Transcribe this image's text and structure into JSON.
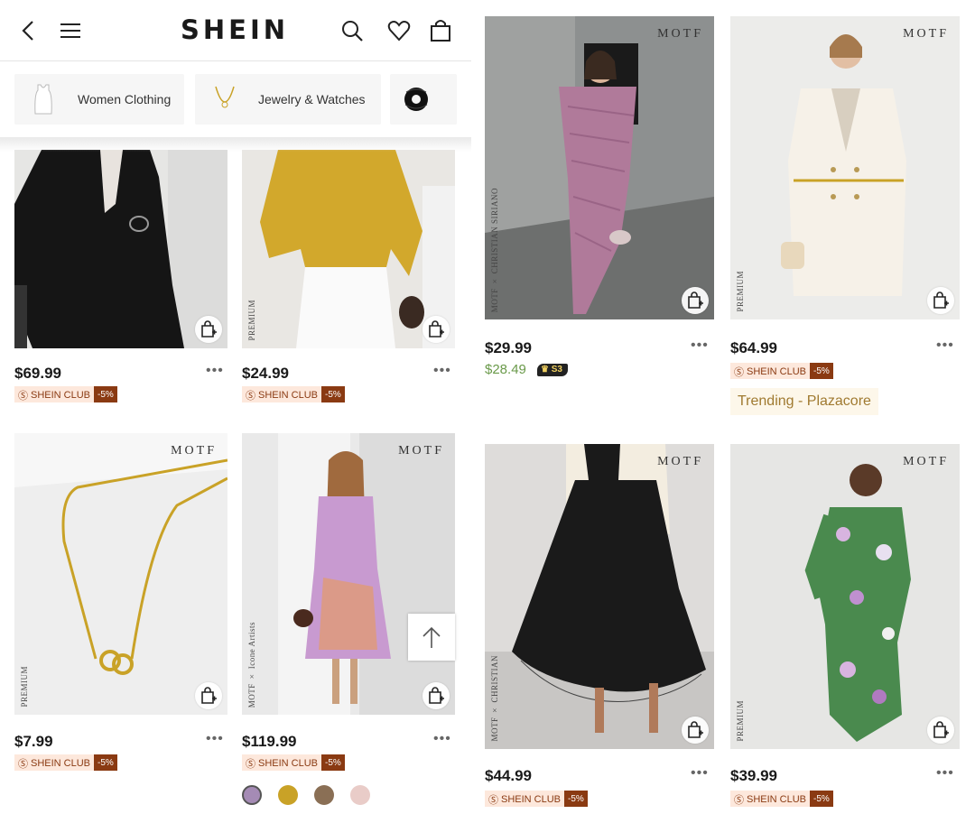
{
  "header": {
    "logo": "SHEIN",
    "icons": [
      "back-arrow-icon",
      "menu-icon",
      "search-icon",
      "heart-icon",
      "bag-icon"
    ]
  },
  "categories": [
    {
      "label": "Women Clothing",
      "icon": "tank-top-icon"
    },
    {
      "label": "Jewelry & Watches",
      "icon": "necklace-icon"
    },
    {
      "label": "",
      "icon": "scrunchie-icon"
    }
  ],
  "left_products": [
    {
      "price": "$69.99",
      "club": "SHEIN CLUB",
      "discount": "-5%",
      "image": "black blazer with belt"
    },
    {
      "price": "$24.99",
      "club": "SHEIN CLUB",
      "discount": "-5%",
      "tag": "PREMIUM",
      "image": "mustard blouse with white pants"
    },
    {
      "price": "$7.99",
      "club": "SHEIN CLUB",
      "discount": "-5%",
      "tag": "PREMIUM",
      "brand": "MOTF",
      "image": "gold layered necklace"
    },
    {
      "price": "$119.99",
      "club": "SHEIN CLUB",
      "discount": "-5%",
      "tag": "MOTF × Icone Artists",
      "brand": "MOTF",
      "image": "tie-dye twist front dress"
    }
  ],
  "right_products": [
    {
      "price": "$29.99",
      "club_price": "$28.49",
      "badge": "S3",
      "brand": "MOTF",
      "tag": "MOTF × CHRISTIAN SIRIANO",
      "image": "mauve off-shoulder ruched dress"
    },
    {
      "price": "$64.99",
      "club": "SHEIN CLUB",
      "discount": "-5%",
      "brand": "MOTF",
      "tag": "PREMIUM",
      "trending": "Trending - Plazacore",
      "image": "cream tweed blazer dress"
    },
    {
      "price": "$44.99",
      "club": "SHEIN CLUB",
      "discount": "-5%",
      "brand": "MOTF",
      "tag": "MOTF × CHRISTIAN",
      "image": "black tulle midi skirt"
    },
    {
      "price": "$39.99",
      "club": "SHEIN CLUB",
      "discount": "-5%",
      "brand": "MOTF",
      "tag": "PREMIUM",
      "image": "green floral print dress"
    }
  ],
  "colors": {
    "swatches": [
      "#a58bb5",
      "#c9a227",
      "#8a6f55",
      "#e9ccc8"
    ],
    "club_bg": "#fde8dc",
    "club_text": "#8a3a12",
    "green_price": "#6a9a4a"
  }
}
